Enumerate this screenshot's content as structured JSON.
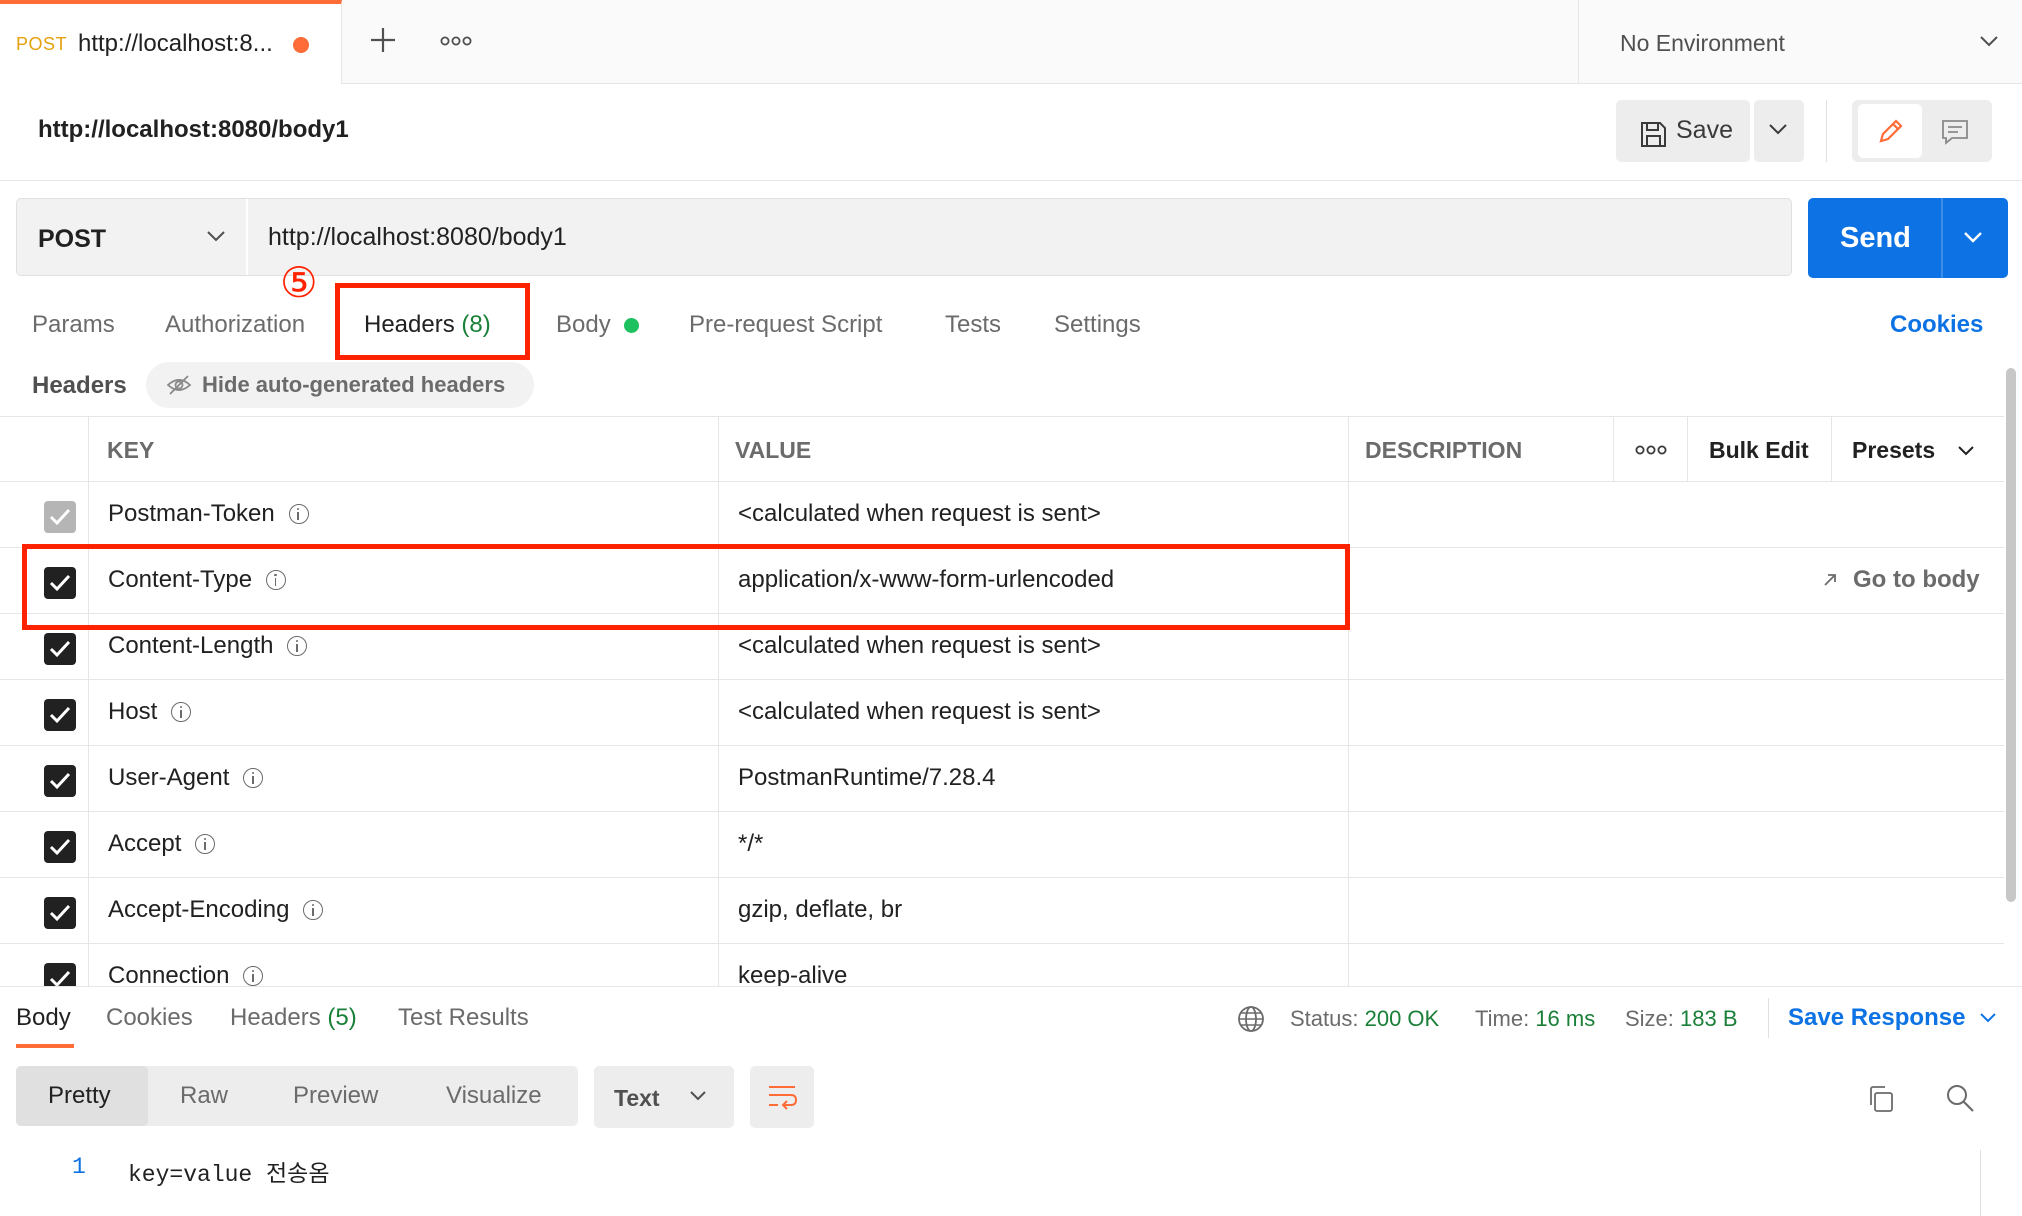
{
  "tab": {
    "method": "POST",
    "title": "http://localhost:8...",
    "unsaved_color": "#ff6c37"
  },
  "environment": {
    "selected": "No Environment"
  },
  "request": {
    "title": "http://localhost:8080/body1",
    "method": "POST",
    "url": "http://localhost:8080/body1",
    "save_label": "Save",
    "send_label": "Send"
  },
  "request_tabs": {
    "params": "Params",
    "authorization": "Authorization",
    "headers": "Headers",
    "headers_count": "(8)",
    "body": "Body",
    "pre_request": "Pre-request Script",
    "tests": "Tests",
    "settings": "Settings",
    "cookies": "Cookies"
  },
  "annotation_marker": "⑤",
  "headers_section": {
    "label": "Headers",
    "hide_auto": "Hide auto-generated headers"
  },
  "table": {
    "columns": {
      "key": "KEY",
      "value": "VALUE",
      "description": "DESCRIPTION",
      "bulk_edit": "Bulk Edit",
      "presets": "Presets"
    },
    "go_to_body": "Go to body",
    "rows": [
      {
        "key": "Postman-Token",
        "value": "<calculated when request is sent>",
        "checked": true,
        "disabled": true
      },
      {
        "key": "Content-Type",
        "value": "application/x-www-form-urlencoded",
        "checked": true
      },
      {
        "key": "Content-Length",
        "value": "<calculated when request is sent>",
        "checked": true
      },
      {
        "key": "Host",
        "value": "<calculated when request is sent>",
        "checked": true
      },
      {
        "key": "User-Agent",
        "value": "PostmanRuntime/7.28.4",
        "checked": true
      },
      {
        "key": "Accept",
        "value": "*/*",
        "checked": true
      },
      {
        "key": "Accept-Encoding",
        "value": "gzip, deflate, br",
        "checked": true
      },
      {
        "key": "Connection",
        "value": "keep-alive",
        "checked": true
      }
    ]
  },
  "response": {
    "tabs": {
      "body": "Body",
      "cookies": "Cookies",
      "headers": "Headers",
      "headers_count": "(5)",
      "test_results": "Test Results"
    },
    "status_label": "Status:",
    "status_value": "200 OK",
    "time_label": "Time:",
    "time_value": "16 ms",
    "size_label": "Size:",
    "size_value": "183 B",
    "save_response": "Save Response",
    "formats": {
      "pretty": "Pretty",
      "raw": "Raw",
      "preview": "Preview",
      "visualize": "Visualize"
    },
    "content_type": "Text",
    "body_lines": [
      {
        "line": "1",
        "text": "key=value 전송옴"
      }
    ]
  },
  "colors": {
    "accent": "#0d72e3",
    "brand": "#ff6c37",
    "success": "#1a7f37",
    "highlight": "#ff2200"
  }
}
